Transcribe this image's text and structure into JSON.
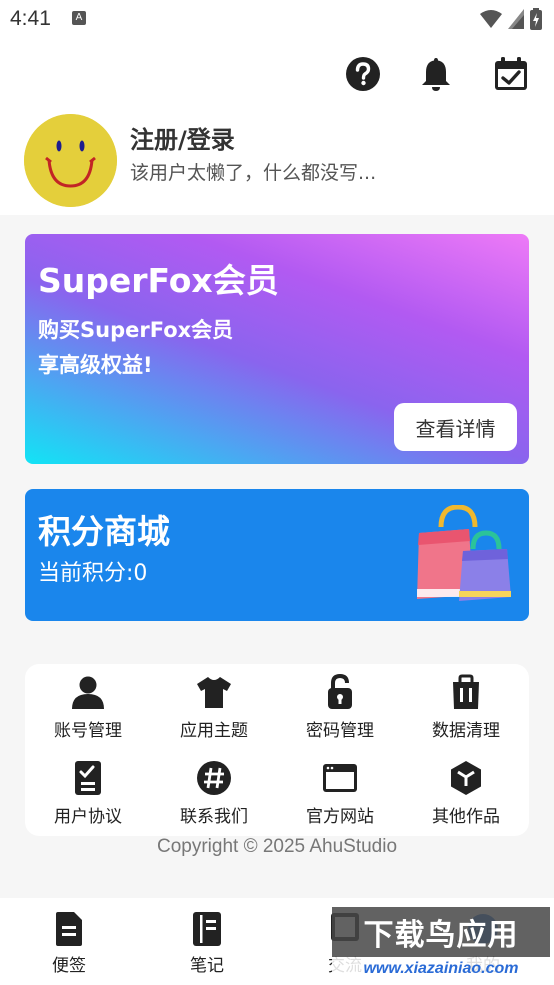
{
  "status_bar": {
    "time": "4:41",
    "notification_badge": "A"
  },
  "header": {
    "icons": [
      "help-icon",
      "bell-icon",
      "calendar-check-icon"
    ],
    "user_name": "注册/登录",
    "user_bio": "该用户太懒了，什么都没写..."
  },
  "vip": {
    "title": "SuperFox会员",
    "desc_line1": "购买SuperFox会员",
    "desc_line2": "享高级权益!",
    "button": "查看详情"
  },
  "points": {
    "title": "积分商城",
    "current": "当前积分:0"
  },
  "menu": {
    "items": [
      {
        "label": "账号管理",
        "icon": "user-icon"
      },
      {
        "label": "应用主题",
        "icon": "shirt-icon"
      },
      {
        "label": "密码管理",
        "icon": "lock-icon"
      },
      {
        "label": "数据清理",
        "icon": "trash-icon"
      },
      {
        "label": "用户协议",
        "icon": "document-check-icon"
      },
      {
        "label": "联系我们",
        "icon": "hashtag-icon"
      },
      {
        "label": "官方网站",
        "icon": "browser-window-icon"
      },
      {
        "label": "其他作品",
        "icon": "cube-icon"
      }
    ]
  },
  "copyright": "Copyright © 2025 AhuStudio",
  "bottom_nav": {
    "items": [
      {
        "label": "便签",
        "icon": "note-icon"
      },
      {
        "label": "笔记",
        "icon": "notebook-icon"
      },
      {
        "label": "交流",
        "icon": "chat-icon"
      },
      {
        "label": "我的",
        "icon": "profile-icon"
      }
    ]
  },
  "watermark": {
    "text": "下载鸟应用",
    "url": "www.xiazainiao.com"
  },
  "colors": {
    "points_card": "#1a86ec",
    "avatar": "#e4cf3b",
    "icon": "#222222"
  }
}
